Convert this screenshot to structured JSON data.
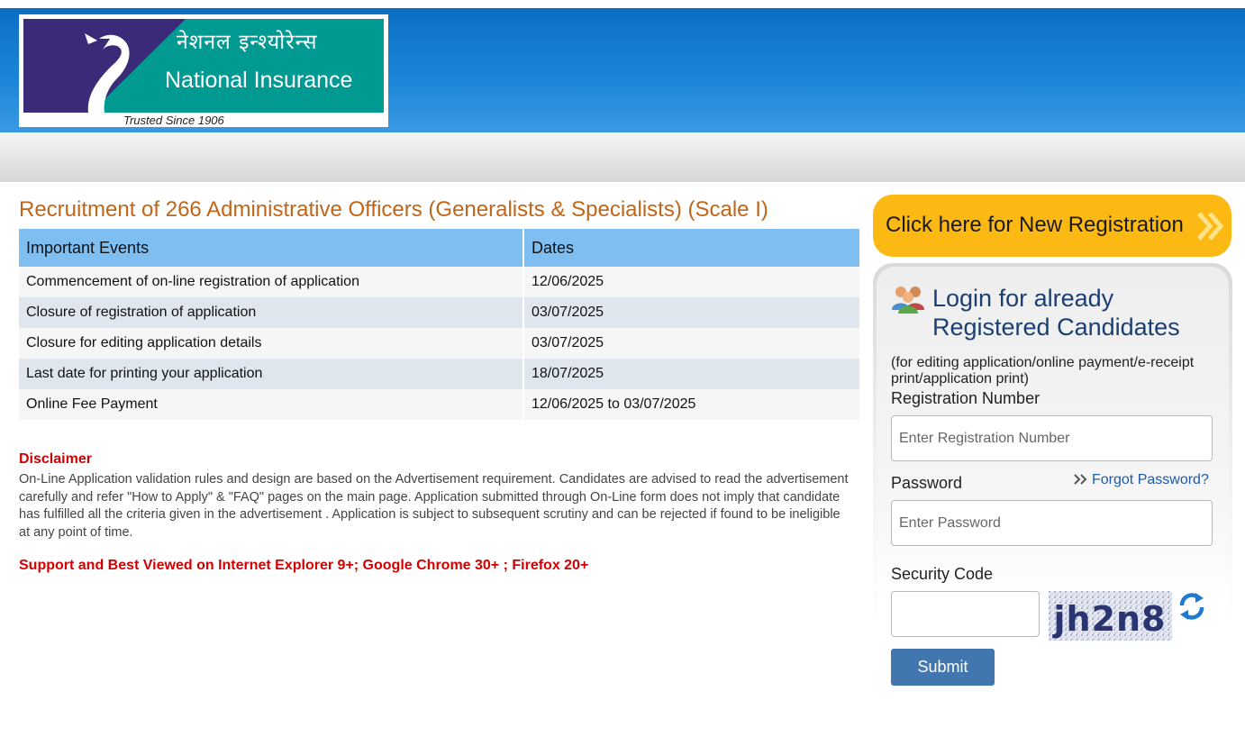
{
  "header": {
    "logo_hindi": "नेशनल इन्श्योरेन्स",
    "logo_english": "National Insurance",
    "logo_tagline": "Trusted Since 1906",
    "logo_icon": "peacock-logo-icon"
  },
  "main": {
    "title": "Recruitment of 266 Administrative Officers (Generalists & Specialists) (Scale I)",
    "events_table": {
      "headers": [
        "Important Events",
        "Dates"
      ],
      "rows": [
        [
          "Commencement of on-line registration of application",
          "12/06/2025"
        ],
        [
          "Closure of registration of application",
          "03/07/2025"
        ],
        [
          "Closure for editing application details",
          "03/07/2025"
        ],
        [
          "Last date for printing your application",
          "18/07/2025"
        ],
        [
          "Online Fee Payment",
          "12/06/2025 to 03/07/2025"
        ]
      ]
    },
    "disclaimer_heading": "Disclaimer",
    "disclaimer_text": "On-Line Application validation rules and design are based on the Advertisement requirement. Candidates are advised to read the advertisement carefully and refer \"How to Apply\" & \"FAQ\" pages on the main page. Application submitted through On-Line form does not imply that candidate has fulfilled all the criteria given in the advertisement . Application is subject to subsequent scrutiny and can be rejected if found to be ineligible at any point of time.",
    "support_text": "Support and Best Viewed on Internet Explorer 9+; Google Chrome 30+ ; Firefox 20+"
  },
  "sidebar": {
    "new_registration_label": "Click here for New Registration",
    "login_title": "Login for already Registered Candidates",
    "login_subtitle": "(for editing application/online payment/e-receipt print/application print)",
    "registration_label": "Registration Number",
    "registration_placeholder": "Enter Registration Number",
    "password_label": "Password",
    "password_placeholder": "Enter Password",
    "forgot_password": "Forgot Password?",
    "security_code_label": "Security Code",
    "captcha_text": "jh2n8",
    "submit_label": "Submit"
  },
  "colors": {
    "header_blue": "#1a84d9",
    "logo_teal": "#009a93",
    "logo_navy": "#3b2a78",
    "title_orange": "#c0661a",
    "table_header": "#7fbef0",
    "alert_red": "#d40000",
    "registration_yellow": "#fdb913",
    "submit_blue": "#4176ae",
    "link_blue": "#1e5aa8"
  }
}
